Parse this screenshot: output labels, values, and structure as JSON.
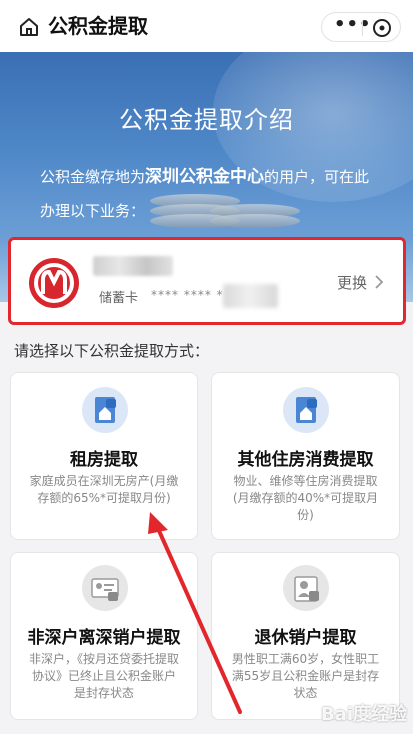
{
  "nav": {
    "title": "公积金提取",
    "more": "•••"
  },
  "banner": {
    "title": "公积金提取介绍",
    "text_prefix": "公积金缴存地为",
    "text_highlight": "深圳公积金中心",
    "text_suffix": "的用户，可在此办理以下业务："
  },
  "bank_card": {
    "card_type": "储蓄卡",
    "card_mask": "**** **** *",
    "change_label": "更换",
    "brand_color": "#d7262d"
  },
  "section_prompt": "请选择以下公积金提取方式：",
  "options": [
    {
      "title": "租房提取",
      "desc": "家庭成员在深圳无房产(月缴存额的65%*可提取月份)",
      "icon": "rent-house-icon"
    },
    {
      "title": "其他住房消费提取",
      "desc": "物业、维修等住房消费提取(月缴存额的40%*可提取月份)",
      "icon": "housing-consumption-icon"
    },
    {
      "title": "非深户离深销户提取",
      "desc": "非深户，《按月还贷委托提取协议》已终止且公积金账户是封存状态",
      "icon": "non-resident-leave-icon"
    },
    {
      "title": "退休销户提取",
      "desc": "男性职工满60岁，女性职工满55岁且公积金账户是封存状态",
      "icon": "retirement-icon"
    }
  ],
  "annotation": {
    "color": "#e3262b"
  },
  "watermark": "Bai度经验"
}
